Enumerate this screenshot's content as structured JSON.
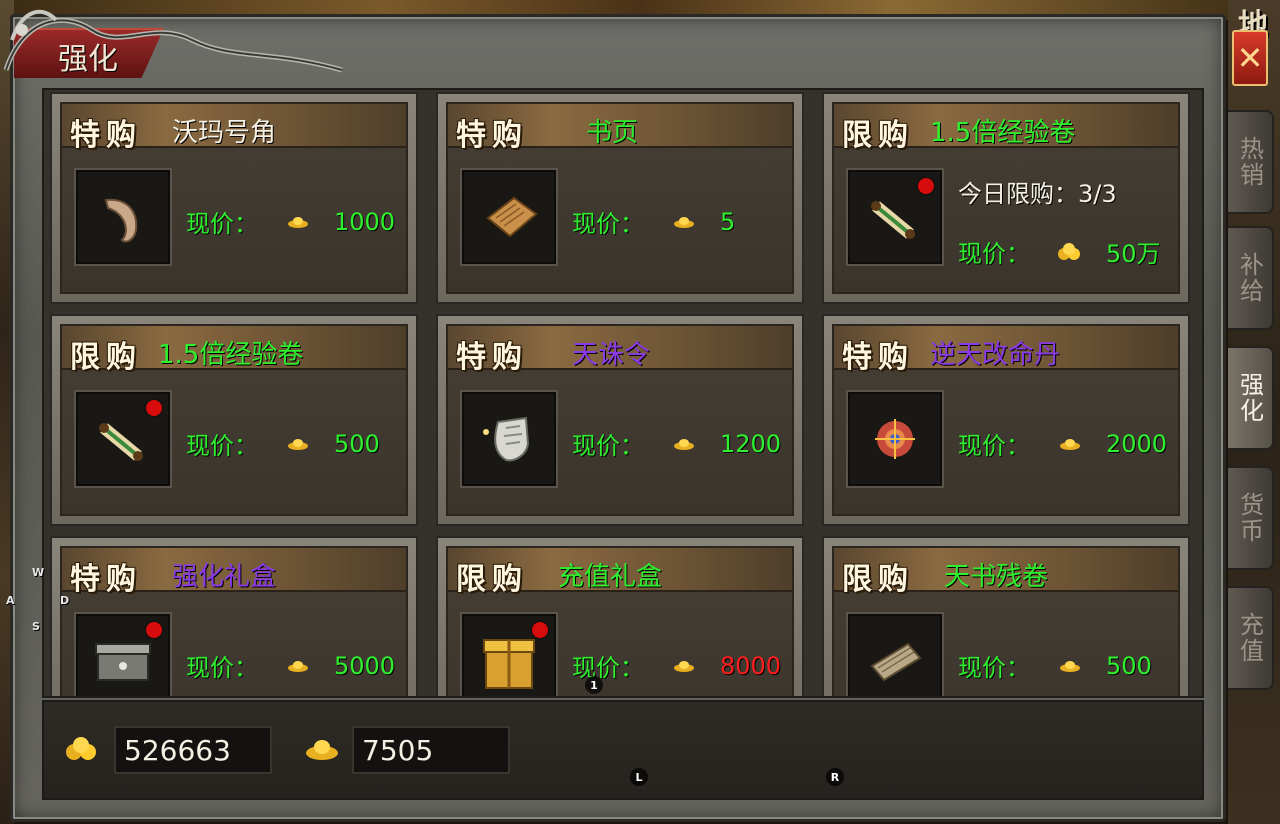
{
  "window": {
    "title": "强化",
    "map_char": "地",
    "close_label": "✕"
  },
  "side_tabs": [
    {
      "label": "热销"
    },
    {
      "label": "补给"
    },
    {
      "label": "强化"
    },
    {
      "label": "货币"
    },
    {
      "label": "充值"
    }
  ],
  "shop": {
    "price_label": "现价：",
    "limit_label": "今日限购：",
    "items": [
      {
        "tag": "特购",
        "name": "沃玛号角",
        "price": "1000",
        "currency": "gold-ingot-icon",
        "name_color": "white"
      },
      {
        "tag": "特购",
        "name": "书页",
        "price": "5",
        "currency": "gold-ingot-icon",
        "name_color": "green"
      },
      {
        "tag": "限购",
        "name": "1.5倍经验卷",
        "price": "50万",
        "limit": "3/3",
        "currency": "gold-coins-icon",
        "name_color": "green",
        "badge": true
      },
      {
        "tag": "限购",
        "name": "1.5倍经验卷",
        "price": "500",
        "currency": "gold-ingot-icon",
        "name_color": "green",
        "badge": true
      },
      {
        "tag": "特购",
        "name": "天诛令",
        "price": "1200",
        "currency": "gold-ingot-icon",
        "name_color": "purple"
      },
      {
        "tag": "特购",
        "name": "逆天改命丹",
        "price": "2000",
        "currency": "gold-ingot-icon",
        "name_color": "purple"
      },
      {
        "tag": "特购",
        "name": "强化礼盒",
        "price": "5000",
        "currency": "gold-ingot-icon",
        "name_color": "purple",
        "badge": true
      },
      {
        "tag": "限购",
        "name": "充值礼盒",
        "price": "8000",
        "currency": "gold-ingot-icon",
        "name_color": "green",
        "price_color": "red",
        "badge": true
      },
      {
        "tag": "限购",
        "name": "天书残卷",
        "price": "500",
        "currency": "gold-ingot-icon",
        "name_color": "green"
      }
    ]
  },
  "wallet": {
    "gold_coins": "526663",
    "gold_ingots": "7505"
  },
  "overlay_keys": {
    "w": "W",
    "a": "A",
    "s": "S",
    "d": "D",
    "one": "1",
    "l": "L",
    "r": "R"
  },
  "colors": {
    "green": "#2ef02e",
    "purple": "#8a3ae8",
    "red": "#ff1e1e",
    "white": "#f4f0e4",
    "title_red": "#9a2a2a"
  }
}
